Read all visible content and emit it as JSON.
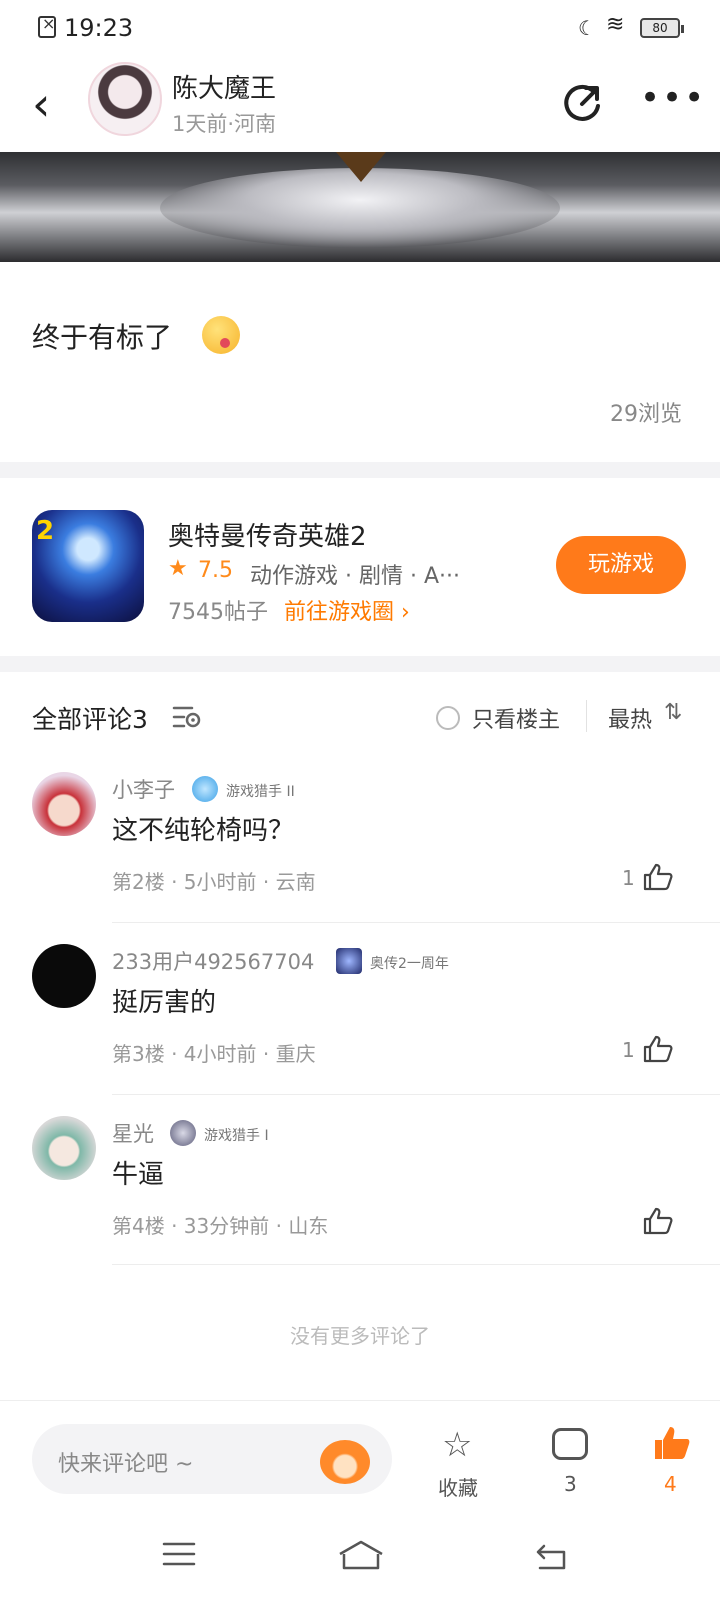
{
  "status_bar": {
    "time": "19:23",
    "battery": "80"
  },
  "header": {
    "author_name": "陈大魔王",
    "author_meta": "1天前·河南"
  },
  "post": {
    "text": "终于有标了",
    "views": "29浏览"
  },
  "game_card": {
    "title": "奥特曼传奇英雄2",
    "rating": "7.5",
    "tags": "动作游戏 · 剧情 · A···",
    "posts": "7545帖子",
    "circle_link": "前往游戏圈",
    "play_button": "玩游戏"
  },
  "comments_header": {
    "title": "全部评论3",
    "only_owner": "只看楼主",
    "sort": "最热",
    "sort_arrow": "⇅"
  },
  "comments": [
    {
      "name": "小李子",
      "badge": "游戏猎手 II",
      "text": "这不纯轮椅吗？",
      "meta": "第2楼 · 5小时前 · 云南",
      "likes": "1"
    },
    {
      "name": "233用户492567704",
      "badge": "奥传2一周年",
      "text": "挺厉害的",
      "meta": "第3楼 · 4小时前 · 重庆",
      "likes": "1"
    },
    {
      "name": "星光",
      "badge": "游戏猎手 I",
      "text": "牛逼",
      "meta": "第4楼 · 33分钟前 · 山东",
      "likes": ""
    }
  ],
  "no_more": "没有更多评论了",
  "bottom_bar": {
    "placeholder": "快来评论吧 ~",
    "favorite_label": "收藏",
    "comment_count": "3",
    "like_count": "4"
  },
  "colors": {
    "accent": "#ff7a1a",
    "link": "#ff7a00"
  }
}
